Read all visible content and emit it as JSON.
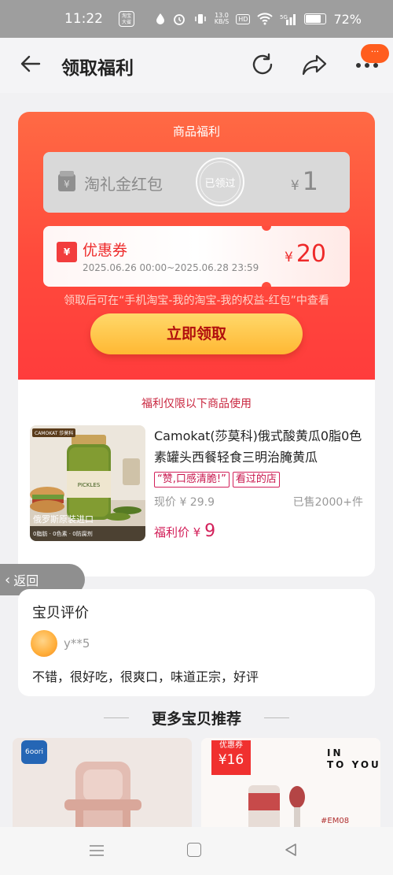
{
  "status_bar": {
    "time": "11:22",
    "app_icon_text": "淘宝 大省",
    "network_speed": "13.0\nKB/S",
    "hd_label": "HD",
    "signal_label": "5G",
    "battery_percent": "72%"
  },
  "nav": {
    "title": "领取福利",
    "badge": "···"
  },
  "welfare": {
    "section_title": "商品福利",
    "gift": {
      "name": "淘礼金红包",
      "stamp": "已领过",
      "currency": "¥",
      "amount": "1",
      "icon": "gift-bag-icon"
    },
    "coupon": {
      "name": "优惠券",
      "icon_text": "¥",
      "date_range": "2025.06.26 00:00~2025.06.28 23:59",
      "currency": "¥",
      "amount": "20"
    },
    "hint": "领取后可在“手机淘宝-我的淘宝-我的权益-红包”中查看",
    "claim_button": "立即领取"
  },
  "product": {
    "limit_text": "福利仅限以下商品使用",
    "image_tag": "CAMOKAT 莎莫科",
    "image_caption": "俄罗斯原装进口",
    "image_features": "0脂肪 · 0色素 · 0防腐剂",
    "title": "Camokat(莎莫科)俄式酸黄瓜0脂0色素罐头西餐轻食三明治腌黄瓜",
    "tags": [
      "“赞,口感清脆!”",
      "看过的店"
    ],
    "current_price": "现价 ¥ 29.9",
    "sold": "已售2000+件",
    "welfare_label": "福利价",
    "welfare_currency": "¥",
    "welfare_amount": "9"
  },
  "float_back": {
    "label": "返回"
  },
  "review": {
    "title": "宝贝评价",
    "user": "y**5",
    "text": "不错，很好吃，很爽口，味道正宗，好评"
  },
  "more": {
    "title": "更多宝贝推荐",
    "left_logo": "6oori",
    "right_coupon_label": "优惠券",
    "right_coupon_amount": "¥16",
    "right_brand": "IN\nTO YOU",
    "right_code": "#EM08"
  },
  "colors": {
    "accent_red": "#ff4a3c",
    "claim_yellow": "#ffc445",
    "price_pink": "#d3205a"
  }
}
